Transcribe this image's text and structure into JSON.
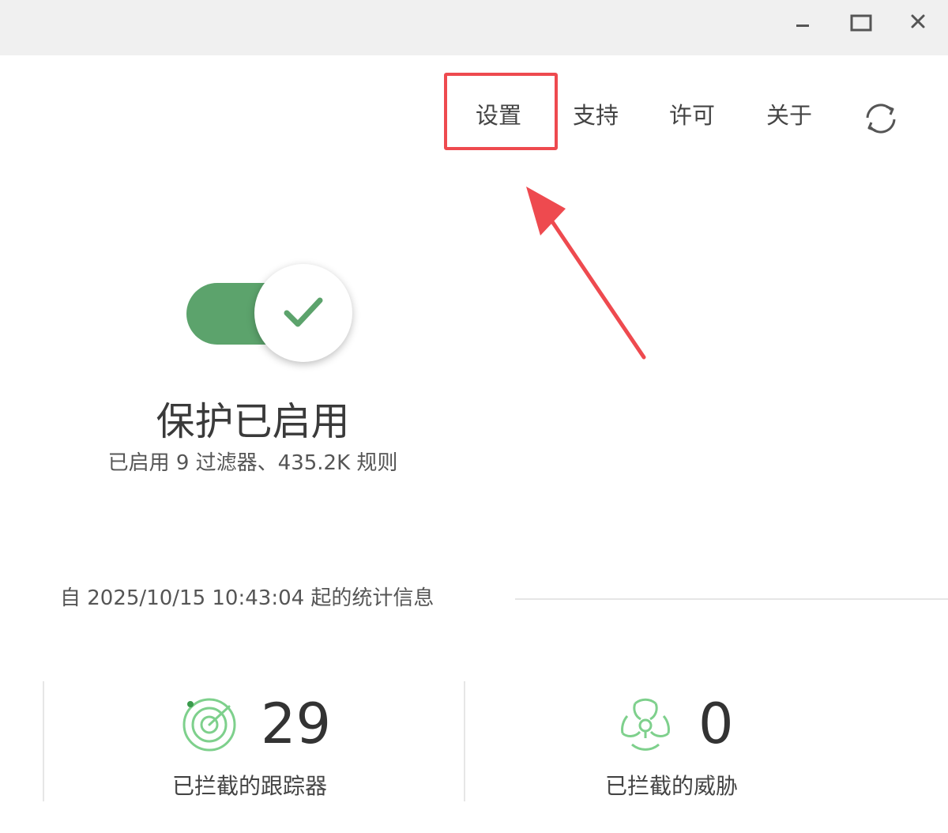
{
  "window": {
    "controls": {
      "minimize": "minimize-icon",
      "maximize": "maximize-icon",
      "close": "close-icon"
    }
  },
  "nav": {
    "settings_label": "设置",
    "support_label": "支持",
    "license_label": "许可",
    "about_label": "关于",
    "refresh_icon": "refresh-icon"
  },
  "protection": {
    "enabled": true,
    "title": "保护已启用",
    "subtitle": "已启用 9 过滤器、435.2K 规则"
  },
  "statistics": {
    "header": "自 2025/10/15 10:43:04 起的统计信息",
    "items": [
      {
        "icon": "radar-icon",
        "value": "29",
        "label": "已拦截的跟踪器"
      },
      {
        "icon": "biohazard-icon",
        "value": "0",
        "label": "已拦截的威胁"
      }
    ]
  },
  "annotation": {
    "highlight_color": "#ee4a4f",
    "target": "设置"
  },
  "colors": {
    "accent_green": "#5ca36c",
    "icon_green": "#7ed08c",
    "text_dark": "#333333"
  }
}
